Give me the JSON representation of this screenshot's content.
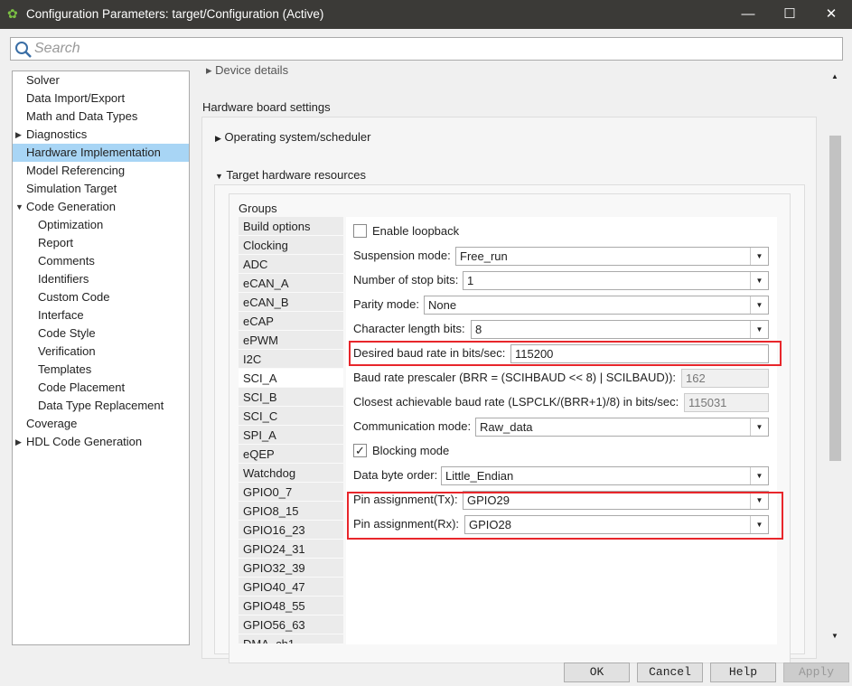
{
  "window": {
    "title": "Configuration Parameters: target/Configuration (Active)",
    "minimize": "—",
    "maximize": "☐",
    "close": "✕"
  },
  "search": {
    "placeholder": "Search"
  },
  "tree": [
    {
      "label": "Solver",
      "level": 0
    },
    {
      "label": "Data Import/Export",
      "level": 0
    },
    {
      "label": "Math and Data Types",
      "level": 0
    },
    {
      "label": "Diagnostics",
      "level": 0,
      "expander": "collapsed"
    },
    {
      "label": "Hardware Implementation",
      "level": 0,
      "selected": true
    },
    {
      "label": "Model Referencing",
      "level": 0
    },
    {
      "label": "Simulation Target",
      "level": 0
    },
    {
      "label": "Code Generation",
      "level": 0,
      "expander": "expanded"
    },
    {
      "label": "Optimization",
      "level": 1
    },
    {
      "label": "Report",
      "level": 1
    },
    {
      "label": "Comments",
      "level": 1
    },
    {
      "label": "Identifiers",
      "level": 1
    },
    {
      "label": "Custom Code",
      "level": 1
    },
    {
      "label": "Interface",
      "level": 1
    },
    {
      "label": "Code Style",
      "level": 1
    },
    {
      "label": "Verification",
      "level": 1
    },
    {
      "label": "Templates",
      "level": 1
    },
    {
      "label": "Code Placement",
      "level": 1
    },
    {
      "label": "Data Type Replacement",
      "level": 1
    },
    {
      "label": "Coverage",
      "level": 0
    },
    {
      "label": "HDL Code Generation",
      "level": 0,
      "expander": "collapsed"
    }
  ],
  "main": {
    "device_details": "Device details",
    "hardware_board_settings": "Hardware board settings",
    "os_scheduler": "Operating system/scheduler",
    "target_resources": "Target hardware resources",
    "groups_label": "Groups",
    "groups": [
      "Build options",
      "Clocking",
      "ADC",
      "eCAN_A",
      "eCAN_B",
      "eCAP",
      "ePWM",
      "I2C",
      "SCI_A",
      "SCI_B",
      "SCI_C",
      "SPI_A",
      "eQEP",
      "Watchdog",
      "GPIO0_7",
      "GPIO8_15",
      "GPIO16_23",
      "GPIO24_31",
      "GPIO32_39",
      "GPIO40_47",
      "GPIO48_55",
      "GPIO56_63",
      "DMA_ch1"
    ],
    "selected_group": "SCI_A",
    "form": {
      "enable_loopback": {
        "label": "Enable loopback",
        "checked": false
      },
      "suspension_mode": {
        "label": "Suspension mode:",
        "value": "Free_run"
      },
      "stop_bits": {
        "label": "Number of stop bits:",
        "value": "1"
      },
      "parity_mode": {
        "label": "Parity mode:",
        "value": "None"
      },
      "char_length": {
        "label": "Character length bits:",
        "value": "8"
      },
      "desired_baud": {
        "label": "Desired baud rate in bits/sec:",
        "value": "115200"
      },
      "prescaler": {
        "label": "Baud rate prescaler (BRR = (SCIHBAUD << 8) | SCILBAUD)):",
        "value": "162"
      },
      "closest_baud": {
        "label": "Closest achievable baud rate (LSPCLK/(BRR+1)/8) in bits/sec:",
        "value": "115031"
      },
      "comm_mode": {
        "label": "Communication mode:",
        "value": "Raw_data"
      },
      "blocking_mode": {
        "label": "Blocking mode",
        "checked": true
      },
      "byte_order": {
        "label": "Data byte order:",
        "value": "Little_Endian"
      },
      "pin_tx": {
        "label": "Pin assignment(Tx):",
        "value": "GPIO29"
      },
      "pin_rx": {
        "label": "Pin assignment(Rx):",
        "value": "GPIO28"
      }
    }
  },
  "footer": {
    "ok": "OK",
    "cancel": "Cancel",
    "help": "Help",
    "apply": "Apply"
  },
  "colors": {
    "highlight": "#e8262b",
    "selection": "#a8d5f5"
  }
}
